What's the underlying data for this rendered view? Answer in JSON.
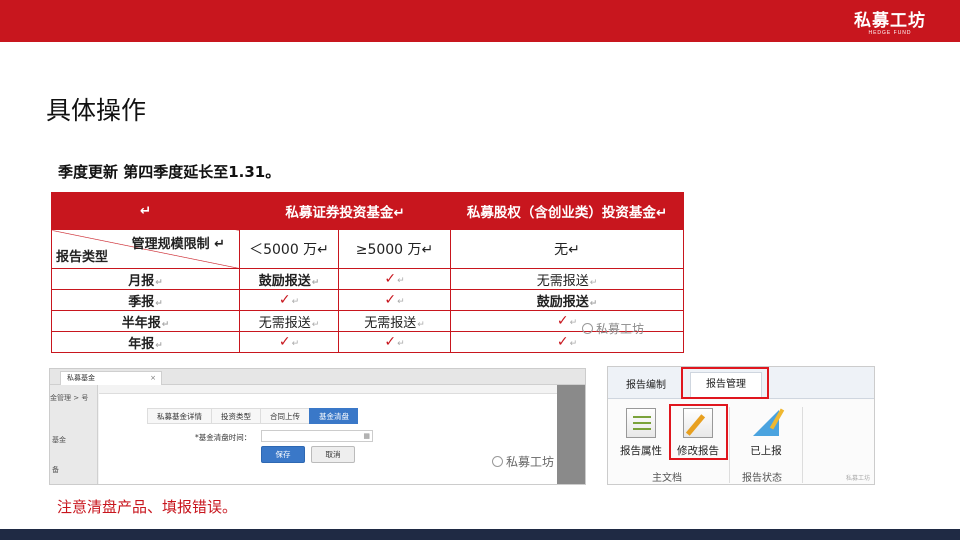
{
  "logo": {
    "main": "私募工坊",
    "sub": "HEDGE FUND"
  },
  "title": "具体操作",
  "subtitle": "季度更新 第四季度延长至1.31。",
  "table": {
    "header_blank": "↵",
    "col_sec": "私募证券投资基金↵",
    "col_pe": "私募股权（含创业类）投资基金↵",
    "diag_top": "管理规模限制 ↵",
    "diag_bottom": "报告类型",
    "scale_lt": "＜5000 万↵",
    "scale_ge": "≥5000 万↵",
    "scale_none": "无↵",
    "rows": [
      {
        "type": "月报",
        "lt": "鼓励报送",
        "ge": "✓",
        "none": "无需报送"
      },
      {
        "type": "季报",
        "lt": "✓",
        "ge": "✓",
        "none": "鼓励报送"
      },
      {
        "type": "半年报",
        "lt": "无需报送",
        "ge": "无需报送",
        "none": "✓"
      },
      {
        "type": "年报",
        "lt": "✓",
        "ge": "✓",
        "none": "✓"
      }
    ],
    "return_mark": "↵"
  },
  "watermark": "私募工坊",
  "screen1": {
    "tab_label": "私募基金",
    "tab_close": "×",
    "left_label_1": "金管理 > 号",
    "left_label_2": "基金",
    "left_label_3": "备",
    "subtabs": [
      "私募基金详情",
      "投资类型",
      "合同上传",
      "基金清盘"
    ],
    "active_subtab": "基金清盘",
    "field_label": "*基金清盘时间：",
    "field_value": "",
    "calendar_icon": "▦",
    "save_label": "保存",
    "cancel_label": "取消"
  },
  "screen2": {
    "tab_edit": "报告编制",
    "tab_mgmt": "报告管理",
    "btn_prop": "报告属性",
    "btn_edit": "修改报告",
    "btn_up": "已上报",
    "group_main": "主文档",
    "group_status": "报告状态",
    "corner_watermark": "私募工坊"
  },
  "note": "注意清盘产品、填报错误。",
  "colors": {
    "brand_red": "#c8161e",
    "footer_navy": "#1f2a44",
    "button_blue": "#3a78c8",
    "highlight_red": "#e0161e"
  }
}
